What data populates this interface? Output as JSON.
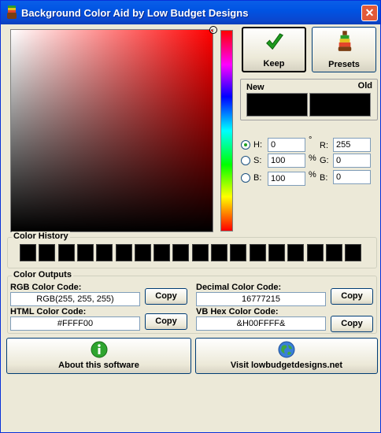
{
  "window": {
    "title": "Background Color Aid by Low Budget Designs",
    "close_glyph": "✕"
  },
  "picker": {
    "hue_marker_color": "#ffffff"
  },
  "buttons": {
    "keep": "Keep",
    "presets": "Presets"
  },
  "compare": {
    "new_label": "New",
    "old_label": "Old",
    "new_color": "#000000",
    "old_color": "#000000"
  },
  "hsb": {
    "h_label": "H:",
    "h_value": "0",
    "h_unit": "°",
    "s_label": "S:",
    "s_value": "100",
    "s_unit": "%",
    "b_label": "B:",
    "b_value": "100",
    "b_unit": "%",
    "selected": "H"
  },
  "rgb": {
    "r_label": "R:",
    "r_value": "255",
    "g_label": "G:",
    "g_value": "0",
    "b_label": "B:",
    "b_value": "0"
  },
  "history": {
    "title": "Color History",
    "swatches": [
      "#000000",
      "#000000",
      "#000000",
      "#000000",
      "#000000",
      "#000000",
      "#000000",
      "#000000",
      "#000000",
      "#000000",
      "#000000",
      "#000000",
      "#000000",
      "#000000",
      "#000000",
      "#000000",
      "#000000",
      "#000000"
    ]
  },
  "outputs": {
    "title": "Color Outputs",
    "rgb_label": "RGB Color Code:",
    "rgb_value": "RGB(255, 255, 255)",
    "html_label": "HTML Color Code:",
    "html_value": "#FFFF00",
    "decimal_label": "Decimal Color Code:",
    "decimal_value": "16777215",
    "vb_label": "VB Hex Color Code:",
    "vb_value": "&H00FFFF&",
    "copy_label": "Copy"
  },
  "footer": {
    "about": "About this software",
    "visit": "Visit lowbudgetdesigns.net"
  },
  "icons": {
    "app": "paint-bucket-icon",
    "keep": "checkmark-icon",
    "presets": "paint-tube-icon",
    "about": "info-icon",
    "visit": "globe-icon"
  }
}
